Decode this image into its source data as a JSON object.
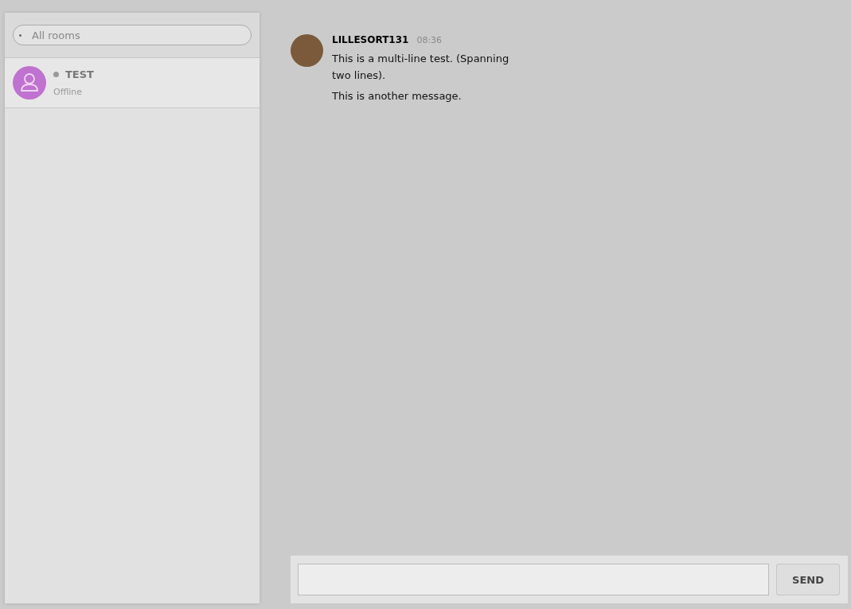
{
  "sidebar": {
    "search": {
      "placeholder": "All rooms"
    },
    "rooms": [
      {
        "name": "TEST",
        "status": "Offline",
        "selected": true,
        "color": "#999999"
      }
    ]
  },
  "messages": [
    {
      "author": "LILLESORT131",
      "time": "08:36",
      "lines": [
        "This is a multi-line test. (Spanning two lines).",
        "This is another message."
      ]
    }
  ],
  "composer": {
    "send_label": "SEND"
  }
}
